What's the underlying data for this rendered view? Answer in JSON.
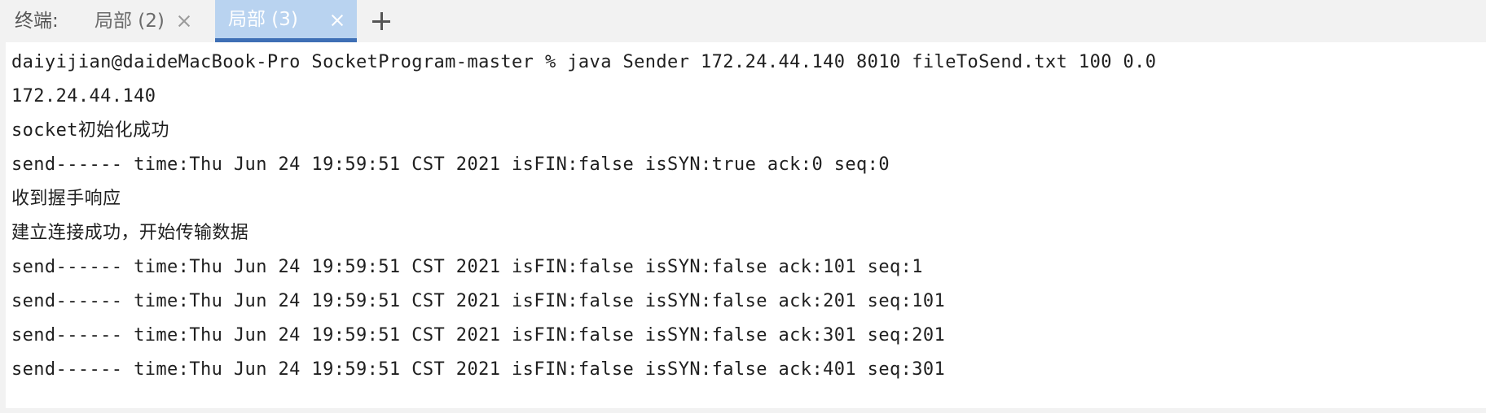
{
  "tabbar": {
    "label": "终端:",
    "tabs": [
      {
        "title": "局部 (2)",
        "active": false
      },
      {
        "title": "局部 (3)",
        "active": true
      }
    ],
    "add_icon": "plus-icon",
    "close_icon": "close-icon"
  },
  "colors": {
    "active_tab_bg": "#b9d3f0",
    "active_tab_underline": "#3e6fb5",
    "terminal_bg": "#ffffff",
    "tabbar_bg": "#f2f2f2"
  },
  "terminal": {
    "lines": [
      "daiyijian@daideMacBook-Pro SocketProgram-master % java Sender 172.24.44.140 8010 fileToSend.txt 100 0.0",
      "172.24.44.140",
      "socket初始化成功",
      "send------ time:Thu Jun 24 19:59:51 CST 2021 isFIN:false isSYN:true ack:0 seq:0",
      "收到握手响应",
      "建立连接成功，开始传输数据",
      "send------ time:Thu Jun 24 19:59:51 CST 2021 isFIN:false isSYN:false ack:101 seq:1",
      "send------ time:Thu Jun 24 19:59:51 CST 2021 isFIN:false isSYN:false ack:201 seq:101",
      "send------ time:Thu Jun 24 19:59:51 CST 2021 isFIN:false isSYN:false ack:301 seq:201",
      "send------ time:Thu Jun 24 19:59:51 CST 2021 isFIN:false isSYN:false ack:401 seq:301"
    ]
  }
}
